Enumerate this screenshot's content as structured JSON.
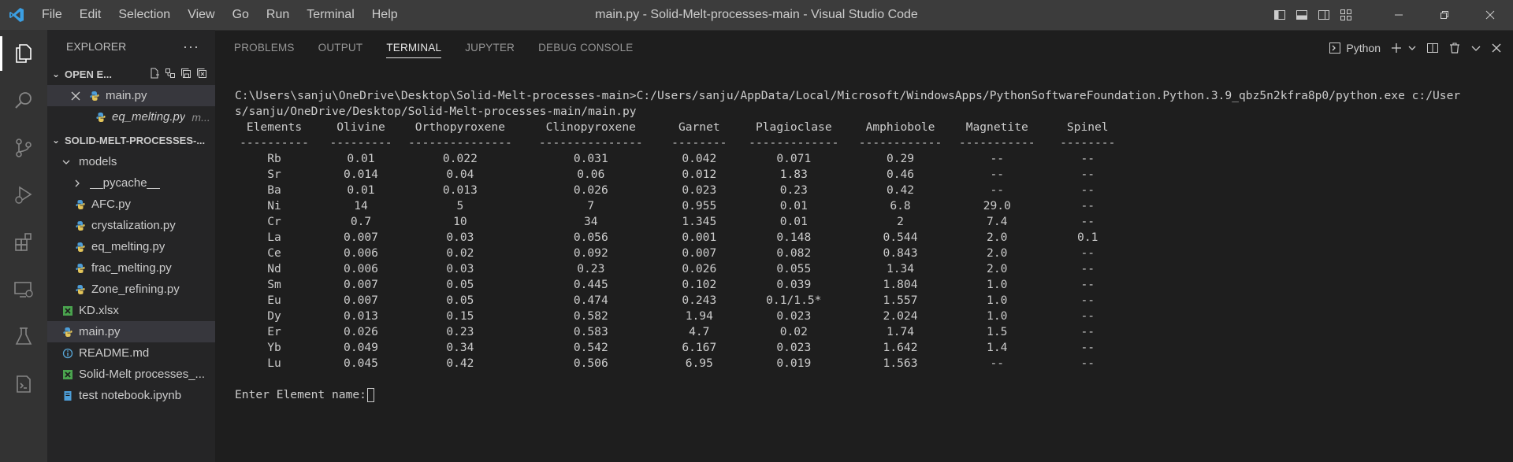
{
  "titlebar": {
    "menu": [
      "File",
      "Edit",
      "Selection",
      "View",
      "Go",
      "Run",
      "Terminal",
      "Help"
    ],
    "title": "main.py - Solid-Melt-processes-main - Visual Studio Code"
  },
  "sidebar": {
    "header": "EXPLORER",
    "open_editors": {
      "label": "OPEN E...",
      "items": [
        {
          "name": "main.py"
        },
        {
          "name": "eq_melting.py",
          "path": "m..."
        }
      ]
    },
    "folder": {
      "label": "SOLID-MELT-PROCESSES-...",
      "items": [
        {
          "name": "models",
          "type": "folder-open",
          "depth": 1
        },
        {
          "name": "__pycache__",
          "type": "folder",
          "depth": 2
        },
        {
          "name": "AFC.py",
          "type": "py",
          "depth": 2
        },
        {
          "name": "crystalization.py",
          "type": "py",
          "depth": 2
        },
        {
          "name": "eq_melting.py",
          "type": "py",
          "depth": 2
        },
        {
          "name": "frac_melting.py",
          "type": "py",
          "depth": 2
        },
        {
          "name": "Zone_refining.py",
          "type": "py",
          "depth": 2
        },
        {
          "name": "KD.xlsx",
          "type": "xlsx",
          "depth": 1
        },
        {
          "name": "main.py",
          "type": "py",
          "depth": 1,
          "selected": true
        },
        {
          "name": "README.md",
          "type": "md",
          "depth": 1
        },
        {
          "name": "Solid-Melt processes_...",
          "type": "xlsx",
          "depth": 1
        },
        {
          "name": "test notebook.ipynb",
          "type": "nb",
          "depth": 1
        }
      ]
    }
  },
  "panel": {
    "tabs": [
      "PROBLEMS",
      "OUTPUT",
      "TERMINAL",
      "JUPYTER",
      "DEBUG CONSOLE"
    ],
    "active_tab": "TERMINAL",
    "terminal_kind": "Python",
    "command_line_1": "C:\\Users\\sanju\\OneDrive\\Desktop\\Solid-Melt-processes-main>C:/Users/sanju/AppData/Local/Microsoft/WindowsApps/PythonSoftwareFoundation.Python.3.9_qbz5n2kfra8p0/python.exe c:/User",
    "command_line_2": "s/sanju/OneDrive/Desktop/Solid-Melt-processes-main/main.py",
    "table": {
      "headers": [
        "Elements",
        "Olivine",
        "Orthopyroxene",
        "Clinopyroxene",
        "Garnet",
        "Plagioclase",
        "Amphiobole",
        "Magnetite",
        "Spinel"
      ],
      "dashes": [
        "----------",
        "---------",
        "---------------",
        "---------------",
        "--------",
        "-------------",
        "------------",
        "-----------",
        "--------"
      ],
      "rows": [
        [
          "Rb",
          "0.01",
          "0.022",
          "0.031",
          "0.042",
          "0.071",
          "0.29",
          "--",
          "--"
        ],
        [
          "Sr",
          "0.014",
          "0.04",
          "0.06",
          "0.012",
          "1.83",
          "0.46",
          "--",
          "--"
        ],
        [
          "Ba",
          "0.01",
          "0.013",
          "0.026",
          "0.023",
          "0.23",
          "0.42",
          "--",
          "--"
        ],
        [
          "Ni",
          "14",
          "5",
          "7",
          "0.955",
          "0.01",
          "6.8",
          "29.0",
          "--"
        ],
        [
          "Cr",
          "0.7",
          "10",
          "34",
          "1.345",
          "0.01",
          "2",
          "7.4",
          "--"
        ],
        [
          "La",
          "0.007",
          "0.03",
          "0.056",
          "0.001",
          "0.148",
          "0.544",
          "2.0",
          "0.1"
        ],
        [
          "Ce",
          "0.006",
          "0.02",
          "0.092",
          "0.007",
          "0.082",
          "0.843",
          "2.0",
          "--"
        ],
        [
          "Nd",
          "0.006",
          "0.03",
          "0.23",
          "0.026",
          "0.055",
          "1.34",
          "2.0",
          "--"
        ],
        [
          "Sm",
          "0.007",
          "0.05",
          "0.445",
          "0.102",
          "0.039",
          "1.804",
          "1.0",
          "--"
        ],
        [
          "Eu",
          "0.007",
          "0.05",
          "0.474",
          "0.243",
          "0.1/1.5*",
          "1.557",
          "1.0",
          "--"
        ],
        [
          "Dy",
          "0.013",
          "0.15",
          "0.582",
          "1.94",
          "0.023",
          "2.024",
          "1.0",
          "--"
        ],
        [
          "Er",
          "0.026",
          "0.23",
          "0.583",
          "4.7",
          "0.02",
          "1.74",
          "1.5",
          "--"
        ],
        [
          "Yb",
          "0.049",
          "0.34",
          "0.542",
          "6.167",
          "0.023",
          "1.642",
          "1.4",
          "--"
        ],
        [
          "Lu",
          "0.045",
          "0.42",
          "0.506",
          "6.95",
          "0.019",
          "1.563",
          "--",
          "--"
        ]
      ]
    },
    "prompt": "Enter Element name:"
  },
  "colors": {
    "vscode_blue": "#3b9fe3",
    "python_blue": "#4d9ed8",
    "python_yellow": "#e3c55a",
    "excel_green": "#4aa34e",
    "info_blue": "#58a6d6"
  }
}
